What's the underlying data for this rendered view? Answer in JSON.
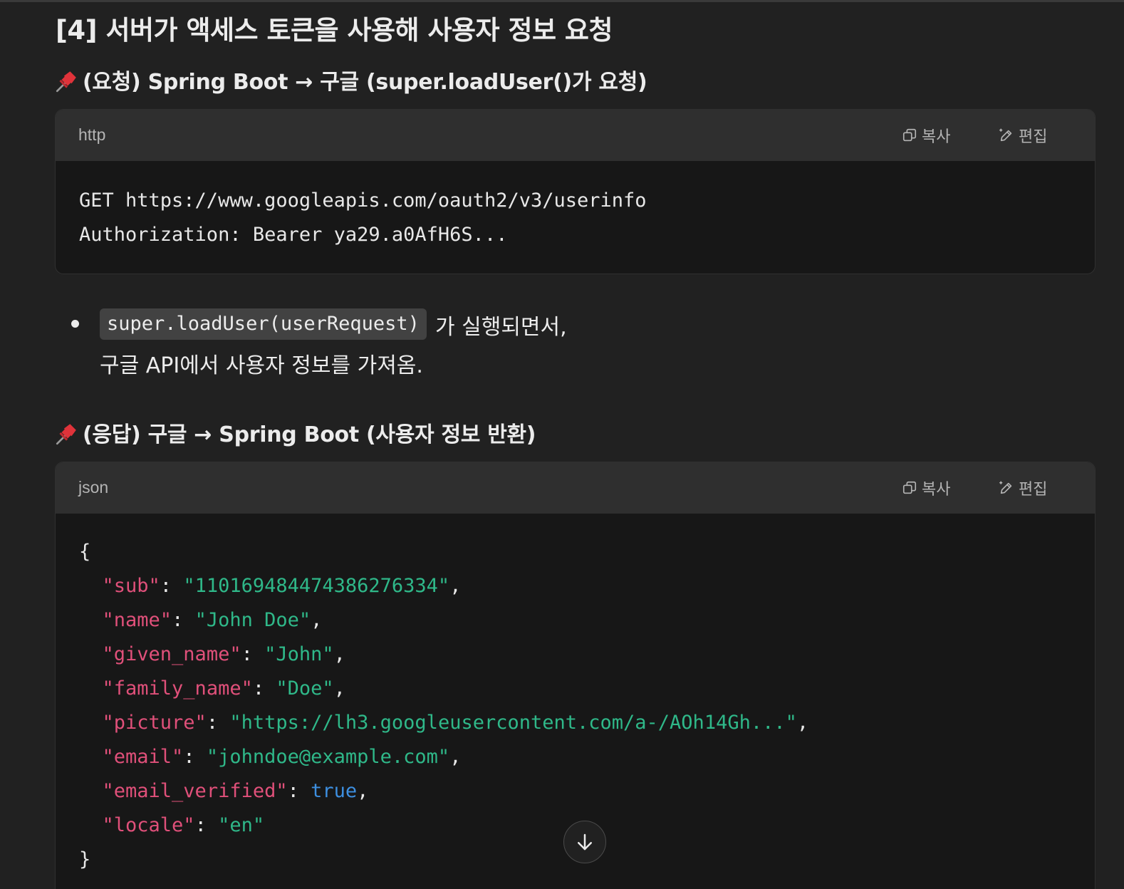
{
  "heading": "[4] 서버가 액세스 토큰을 사용해 사용자 정보 요청",
  "request": {
    "pin_icon": "pushpin-icon",
    "title": "(요청) Spring Boot → 구글 (super.loadUser()가 요청)",
    "code_block": {
      "language": "http",
      "copy_label": "복사",
      "edit_label": "편집",
      "lines": [
        "GET https://www.googleapis.com/oauth2/v3/userinfo",
        "Authorization: Bearer ya29.a0AfH6S..."
      ]
    }
  },
  "bullet": {
    "inline_code": "super.loadUser(userRequest)",
    "text_line1": "가 실행되면서,",
    "text_line2": "구글 API에서 사용자 정보를 가져옴."
  },
  "response": {
    "pin_icon": "pushpin-icon",
    "title": "(응답) 구글 → Spring Boot (사용자 정보 반환)",
    "code_block": {
      "language": "json",
      "copy_label": "복사",
      "edit_label": "편집",
      "open_brace": "{",
      "close_brace": "}",
      "fields": [
        {
          "key": "\"sub\"",
          "value": "\"110169484474386276334\"",
          "type": "string",
          "comma": ","
        },
        {
          "key": "\"name\"",
          "value": "\"John Doe\"",
          "type": "string",
          "comma": ","
        },
        {
          "key": "\"given_name\"",
          "value": "\"John\"",
          "type": "string",
          "comma": ","
        },
        {
          "key": "\"family_name\"",
          "value": "\"Doe\"",
          "type": "string",
          "comma": ","
        },
        {
          "key": "\"picture\"",
          "value": "\"https://lh3.googleusercontent.com/a-/AOh14Gh...\"",
          "type": "string",
          "comma": ","
        },
        {
          "key": "\"email\"",
          "value": "\"johndoe@example.com\"",
          "type": "string",
          "comma": ","
        },
        {
          "key": "\"email_verified\"",
          "value": "true",
          "type": "bool",
          "comma": ","
        },
        {
          "key": "\"locale\"",
          "value": "\"en\"",
          "type": "string",
          "comma": ""
        }
      ]
    }
  },
  "scroll_button_icon": "arrow-down-icon",
  "colors": {
    "background": "#212121",
    "code_bg": "#171717",
    "code_header_bg": "#2f2f2f",
    "json_key": "#e0507a",
    "json_string": "#2fb889",
    "json_bool": "#3d8fe0"
  }
}
